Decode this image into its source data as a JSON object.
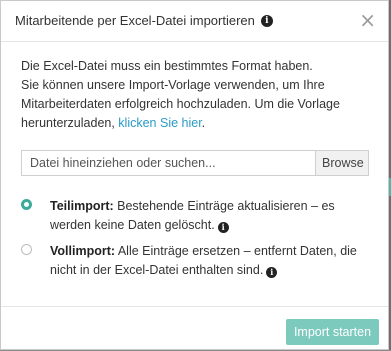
{
  "modal": {
    "title": "Mitarbeitende per Excel-Datei importieren",
    "close_label": "×",
    "description": {
      "line1": "Die Excel-Datei muss ein bestimmtes Format haben.",
      "line2_prefix": "Sie können unsere Import-Vorlage verwenden, um Ihre Mitarbeiterdaten erfolgreich hochzuladen. Um die Vorlage herunterzuladen, ",
      "link": "klicken Sie hier",
      "suffix": "."
    },
    "upload": {
      "placeholder": "Datei hineinziehen oder suchen...",
      "browse_label": "Browse"
    },
    "options": [
      {
        "label": "Teilimport:",
        "description": "Bestehende Einträge aktualisieren – es werden keine Daten gelöscht.",
        "selected": true
      },
      {
        "label": "Vollimport:",
        "description": "Alle Einträge ersetzen – entfernt Daten, die nicht in der Excel-Datei enthalten sind.",
        "selected": false
      }
    ],
    "submit_label": "Import starten"
  },
  "icons": {
    "info": "info-icon",
    "close": "close-icon"
  },
  "colors": {
    "accent": "#3cab9c",
    "button_disabled": "#7cc9be",
    "link": "#2a9bc6"
  }
}
